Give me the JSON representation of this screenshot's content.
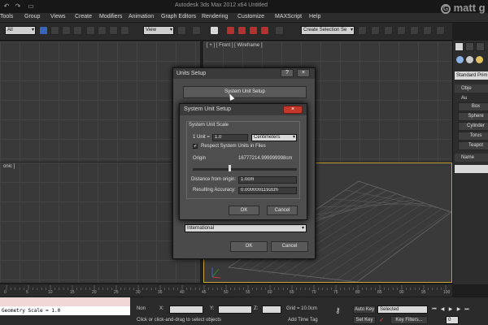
{
  "window": {
    "title": "Autodesk 3ds Max 2012 x64     Untitled"
  },
  "menu": [
    "Tools",
    "Group",
    "Views",
    "Create",
    "Modifiers",
    "Animation",
    "Graph Editors",
    "Rendering",
    "Customize",
    "MAXScript",
    "Help"
  ],
  "toolbar": {
    "selection_filter": "All",
    "ref_coord": "View",
    "named_selection": "Create Selection Se"
  },
  "viewports": {
    "front_label": "[ + ] [ Front ] [ Wireframe ]",
    "left_label": "onic ]"
  },
  "command_panel": {
    "category": "Standard Prim",
    "object_type": "Obje",
    "autogrid": "Au",
    "buttons": [
      "Box",
      "Sphere",
      "Cylinder",
      "Torus",
      "Teapot"
    ],
    "name_rollout": "Name"
  },
  "units_setup": {
    "title": "Units Setup",
    "help": "?",
    "close": "×",
    "system_unit_button": "System Unit Setup",
    "display_scale_value": "International",
    "ok": "OK",
    "cancel": "Cancel"
  },
  "system_unit_setup": {
    "title": "System Unit Setup",
    "close": "×",
    "group_label": "System Unit Scale",
    "unit_label": "1 Unit =",
    "unit_value": "1.0",
    "unit_type": "Centimeters",
    "respect_label": "Respect System Units in Files",
    "respect_checked": "✔",
    "origin_label": "Origin",
    "origin_value": "16777214.999999998cm",
    "distance_label": "Distance from origin:",
    "distance_value": "1.0cm",
    "accuracy_label": "Resulting Accuracy:",
    "accuracy_value": "0.0000001192cm",
    "ok": "OK",
    "cancel": "Cancel"
  },
  "timeline": {
    "ticks": [
      "0",
      "5",
      "10",
      "15",
      "20",
      "25",
      "30",
      "35",
      "40",
      "45",
      "50",
      "55",
      "60",
      "65",
      "70",
      "75",
      "80",
      "85",
      "90",
      "95",
      "100"
    ]
  },
  "status": {
    "listener_output": "Geometry Scale = 1.0",
    "selection_mode": "Non",
    "x_label": "X:",
    "y_label": "Y:",
    "z_label": "Z:",
    "grid": "Grid = 10.0cm",
    "prompt": "Click or click-and-drag to select objects",
    "add_time_tag": "Add Time Tag",
    "auto_key": "Auto Key",
    "set_key": "Set Key",
    "key_mode": "Selected",
    "key_filters": "Key Filters...",
    "frame": "0"
  },
  "watermark": "matt g"
}
